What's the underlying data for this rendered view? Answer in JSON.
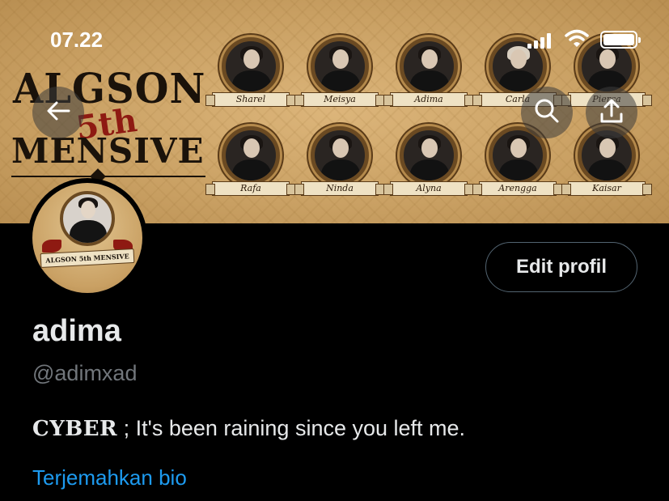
{
  "status_bar": {
    "time": "07.22"
  },
  "banner": {
    "logo": {
      "line1": "ALGSON",
      "line2": "5th",
      "line3": "MENSIVE"
    },
    "members_top": [
      "Sharel",
      "Meisya",
      "Adima",
      "Carla",
      "Pierca"
    ],
    "members_bottom": [
      "Rafa",
      "Ninda",
      "Alyna",
      "Arengga",
      "Kaisar"
    ]
  },
  "header_buttons": {
    "back_icon": "arrow-left-icon",
    "search_icon": "search-icon",
    "share_icon": "share-icon"
  },
  "profile": {
    "avatar_label": "ALGSON 5th MENSIVE",
    "display_name": "adima",
    "handle": "@adimxad",
    "bio_prefix": "CYBER",
    "bio_text": " ; It's been raining since you left me.",
    "translate_link": "Terjemahkan bio",
    "edit_button": "Edit profil"
  },
  "colors": {
    "background": "#000000",
    "link": "#1d9bf0",
    "secondary_text": "#71767b",
    "banner_gold": "#c9a063"
  }
}
